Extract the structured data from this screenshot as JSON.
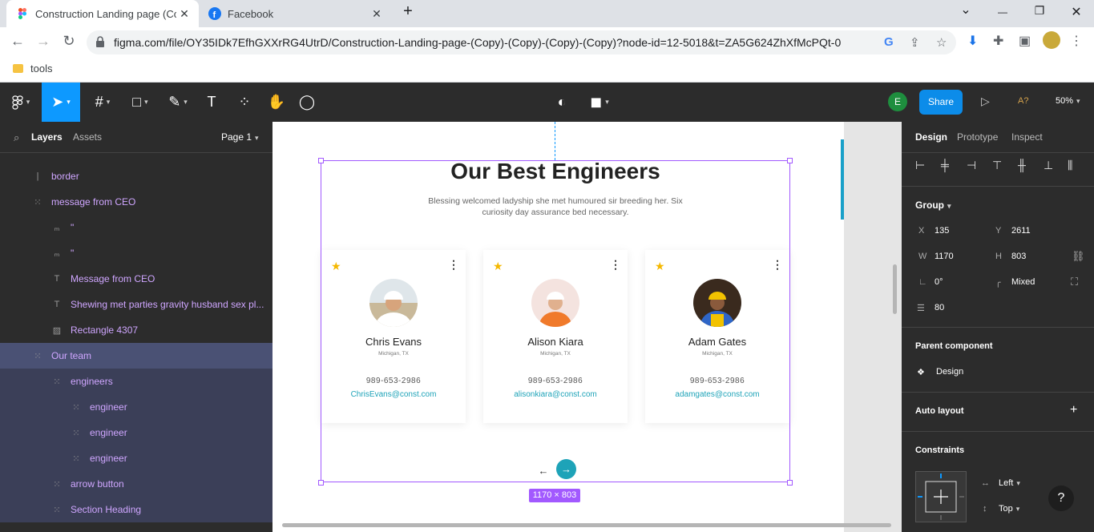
{
  "browser": {
    "tabs": [
      {
        "label": "Construction Landing page (Cop",
        "icon": "figma-icon",
        "active": true
      },
      {
        "label": "Facebook",
        "icon": "facebook-icon",
        "active": false
      }
    ],
    "new_tab": "+",
    "window_controls": {
      "minimize": "—",
      "maximize": "❐",
      "close": "✕",
      "tab_search": "⌄"
    },
    "url": "figma.com/file/OY35IDk7EfhGXXrRG4UtrD/Construction-Landing-page-(Copy)-(Copy)-(Copy)-(Copy)?node-id=12-5018&t=ZA5G624ZhXfMcPQt-0",
    "bookmark": "tools"
  },
  "figma_toolbar": {
    "share_label": "Share",
    "avatar_letter": "E",
    "zoom": "50%",
    "a_label": "A?"
  },
  "layers_panel": {
    "tab_layers": "Layers",
    "tab_assets": "Assets",
    "page": "Page 1",
    "items": [
      {
        "label": "border",
        "icon": "line-icon"
      },
      {
        "label": "message from CEO",
        "icon": "frame-icon"
      },
      {
        "label": "\"",
        "icon": "vector-icon"
      },
      {
        "label": "\"",
        "icon": "vector-icon"
      },
      {
        "label": "Message from CEO",
        "icon": "text-icon"
      },
      {
        "label": "Shewing met parties gravity husband sex pl...",
        "icon": "text-icon"
      },
      {
        "label": "Rectangle 4307",
        "icon": "image-icon"
      },
      {
        "label": "Our team",
        "icon": "frame-icon"
      },
      {
        "label": "engineers",
        "icon": "frame-icon"
      },
      {
        "label": "engineer",
        "icon": "frame-icon"
      },
      {
        "label": "engineer",
        "icon": "frame-icon"
      },
      {
        "label": "engineer",
        "icon": "frame-icon"
      },
      {
        "label": "arrow button",
        "icon": "frame-icon"
      },
      {
        "label": "Section Heading",
        "icon": "frame-icon"
      }
    ]
  },
  "canvas": {
    "heading": "Our Best Engineers",
    "subtext": "Blessing welcomed ladyship she met humoured sir breeding her. Six curiosity day assurance bed necessary.",
    "size_badge": "1170 × 803",
    "engineers": [
      {
        "name": "Chris Evans",
        "location": "Michigan, TX",
        "phone": "989-653-2986",
        "email": "ChrisEvans@const.com"
      },
      {
        "name": "Alison Kiara",
        "location": "Michigan, TX",
        "phone": "989-653-2986",
        "email": "alisonkiara@const.com"
      },
      {
        "name": "Adam Gates",
        "location": "Michigan, TX",
        "phone": "989-653-2986",
        "email": "adamgates@const.com"
      }
    ],
    "arrow_left": "←",
    "arrow_right": "→"
  },
  "design_panel": {
    "tabs": [
      "Design",
      "Prototype",
      "Inspect"
    ],
    "group_label": "Group",
    "x_label": "X",
    "x": "135",
    "y_label": "Y",
    "y": "2611",
    "w_label": "W",
    "w": "1170",
    "h_label": "H",
    "h": "803",
    "rotation": "0°",
    "radius": "Mixed",
    "spacing": "80",
    "parent_component_label": "Parent component",
    "parent_component": "Design",
    "auto_layout_label": "Auto layout",
    "constraints_label": "Constraints",
    "constraint_h": "Left",
    "constraint_v": "Top",
    "help": "?"
  },
  "colors": {
    "accent": "#0d99ff",
    "selection": "#a259ff",
    "teal": "#1ea3b8",
    "star": "#f5b800"
  }
}
